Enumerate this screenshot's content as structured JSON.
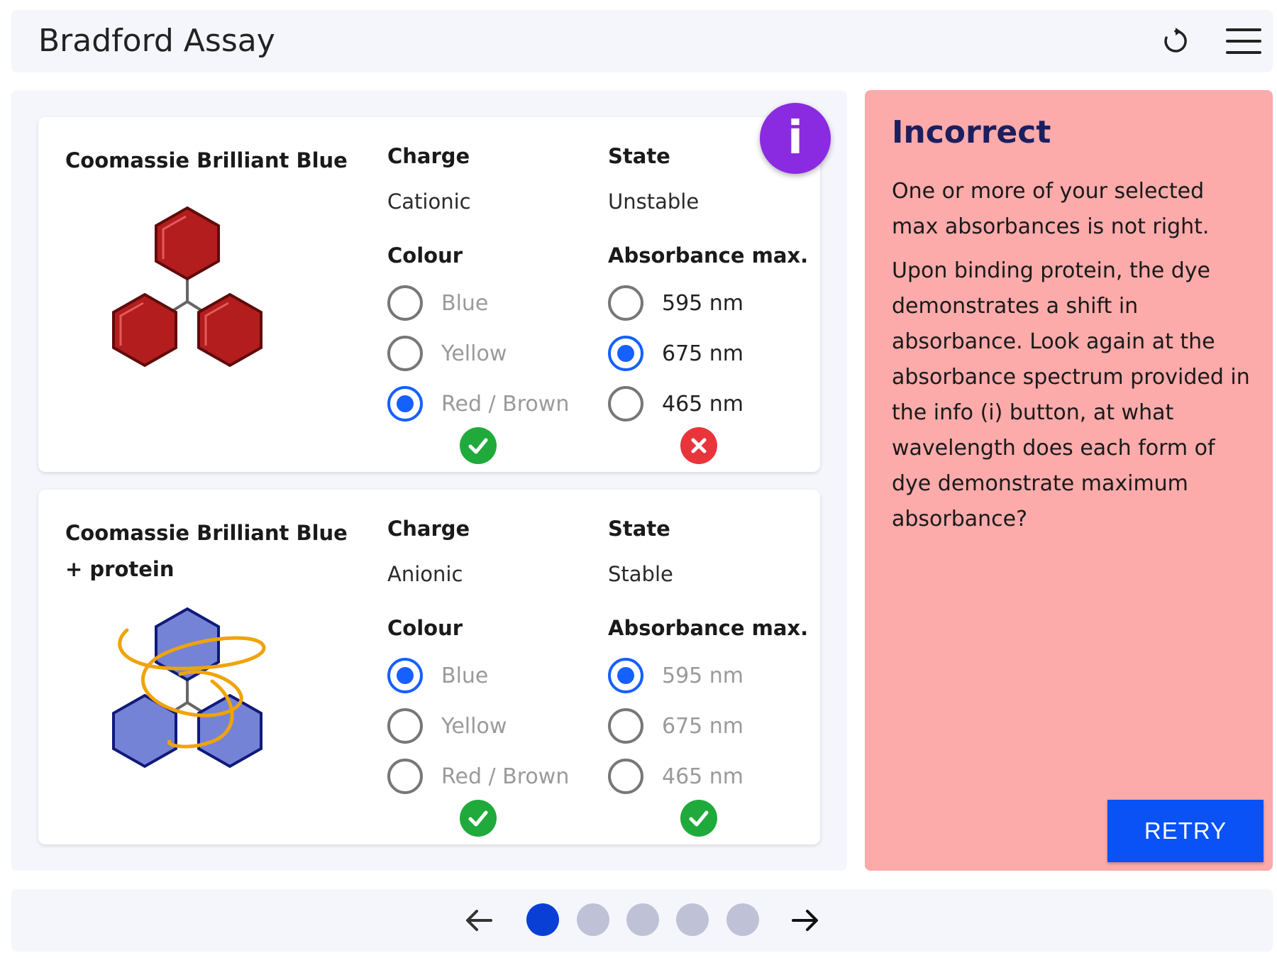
{
  "header": {
    "title": "Bradford Assay",
    "reset_icon": "reset-icon",
    "menu_icon": "hamburger-menu-icon"
  },
  "labels": {
    "charge": "Charge",
    "state": "State",
    "colour": "Colour",
    "absorbance": "Absorbance max."
  },
  "cards": [
    {
      "name": "Coomassie Brilliant Blue",
      "charge": "Cationic",
      "state": "Unstable",
      "colour_options": [
        "Blue",
        "Yellow",
        "Red / Brown"
      ],
      "colour_selected": 2,
      "colour_result": "correct",
      "absorbance_options": [
        "595 nm",
        "675 nm",
        "465 nm"
      ],
      "absorbance_selected": 1,
      "absorbance_result": "incorrect"
    },
    {
      "name": "Coomassie Brilliant Blue + protein",
      "charge": "Anionic",
      "state": "Stable",
      "colour_options": [
        "Blue",
        "Yellow",
        "Red / Brown"
      ],
      "colour_selected": 0,
      "colour_result": "correct",
      "absorbance_options": [
        "595 nm",
        "675 nm",
        "465 nm"
      ],
      "absorbance_selected": 0,
      "absorbance_result": "correct"
    }
  ],
  "info_button": {
    "label": "i"
  },
  "feedback": {
    "title": "Incorrect",
    "paragraph1": "One or more of your selected max absorbances is not right.",
    "paragraph2": "Upon binding protein, the dye demonstrates a shift in absorbance. Look again at the absorbance spectrum provided in the info (i) button, at what wavelength does each form of dye demonstrate maximum absorbance?",
    "retry_label": "RETRY"
  },
  "pagination": {
    "total_pages": 5,
    "current_page": 1
  },
  "colors": {
    "accent": "#1560ff",
    "info": "#8a2be2",
    "feedback_bg": "#fcaaaa",
    "correct": "#1faa3b",
    "incorrect": "#e8353b",
    "retry": "#0a52f5"
  }
}
